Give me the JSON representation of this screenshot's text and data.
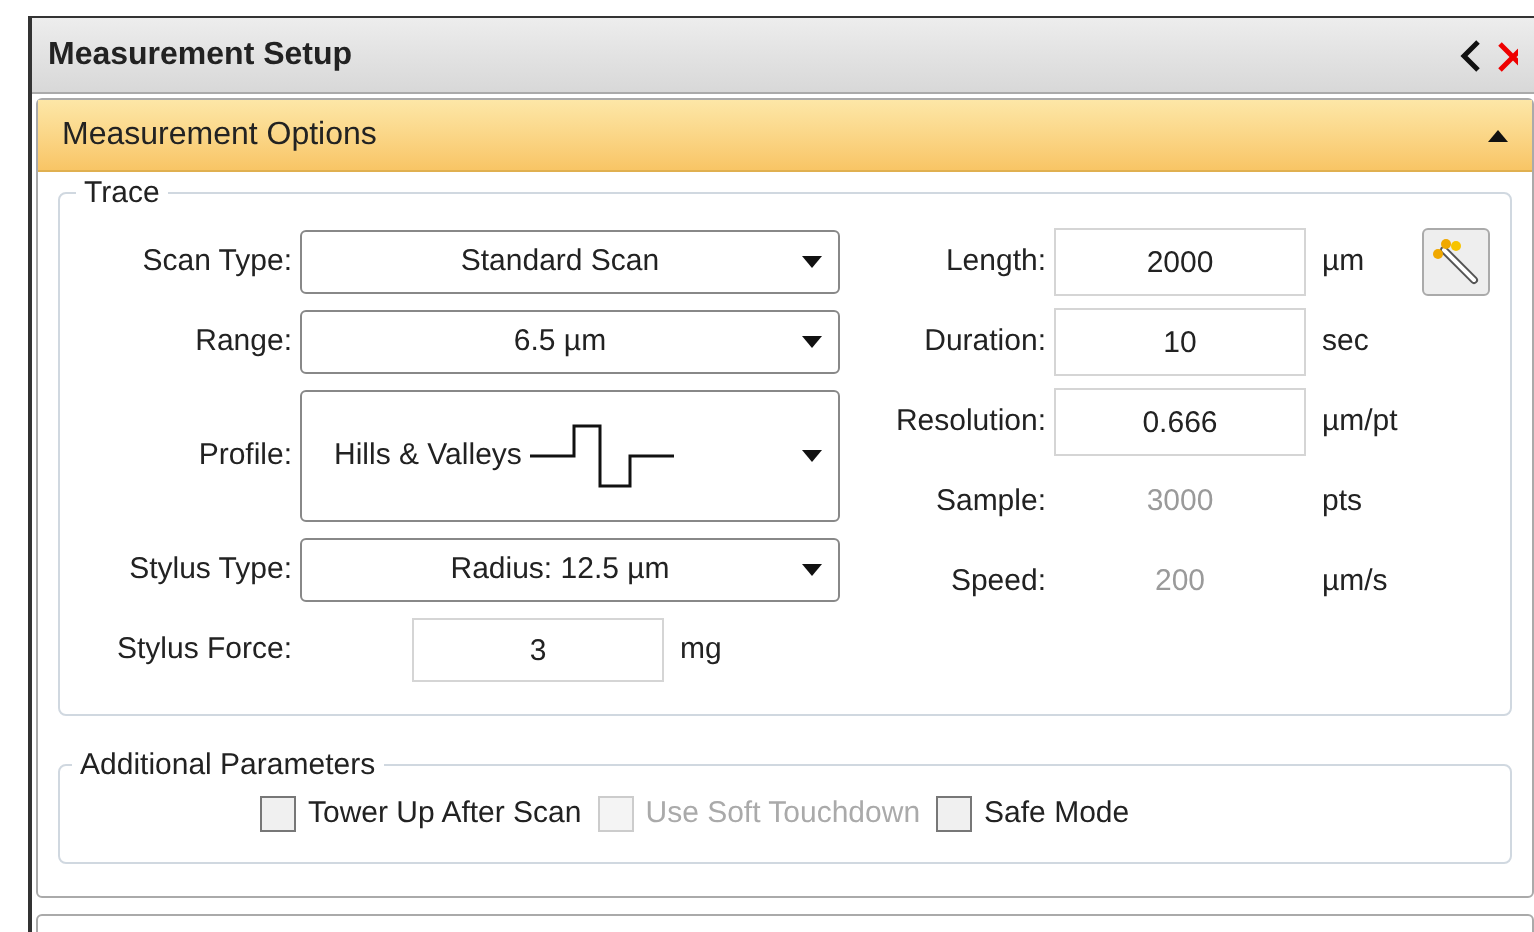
{
  "window": {
    "title": "Measurement Setup"
  },
  "section": {
    "title": "Measurement Options",
    "expanded": true
  },
  "trace": {
    "title": "Trace",
    "left_fields": [
      {
        "kind": "dropdown",
        "label": "Scan Type:",
        "value": "Standard Scan"
      },
      {
        "kind": "dropdown",
        "label": "Range:",
        "value": "6.5 µm"
      },
      {
        "kind": "profile",
        "label": "Profile:",
        "value": "Hills & Valleys"
      },
      {
        "kind": "dropdown",
        "label": "Stylus Type:",
        "value": "Radius: 12.5 µm"
      },
      {
        "kind": "input",
        "label": "Stylus Force:",
        "value": "3",
        "unit": "mg"
      }
    ],
    "right_fields": [
      {
        "kind": "input",
        "label": "Length:",
        "value": "2000",
        "unit": "µm",
        "tool": true
      },
      {
        "kind": "input",
        "label": "Duration:",
        "value": "10",
        "unit": "sec"
      },
      {
        "kind": "input",
        "label": "Resolution:",
        "value": "0.666",
        "unit": "µm/pt"
      },
      {
        "kind": "readout",
        "label": "Sample:",
        "value": "3000",
        "unit": "pts"
      },
      {
        "kind": "readout",
        "label": "Speed:",
        "value": "200",
        "unit": "µm/s"
      }
    ]
  },
  "additional": {
    "title": "Additional Parameters",
    "checkboxes": [
      {
        "label": "Tower Up After Scan",
        "checked": false,
        "disabled": false
      },
      {
        "label": "Use Soft Touchdown",
        "checked": false,
        "disabled": true
      },
      {
        "label": "Safe Mode",
        "checked": false,
        "disabled": false
      }
    ]
  }
}
